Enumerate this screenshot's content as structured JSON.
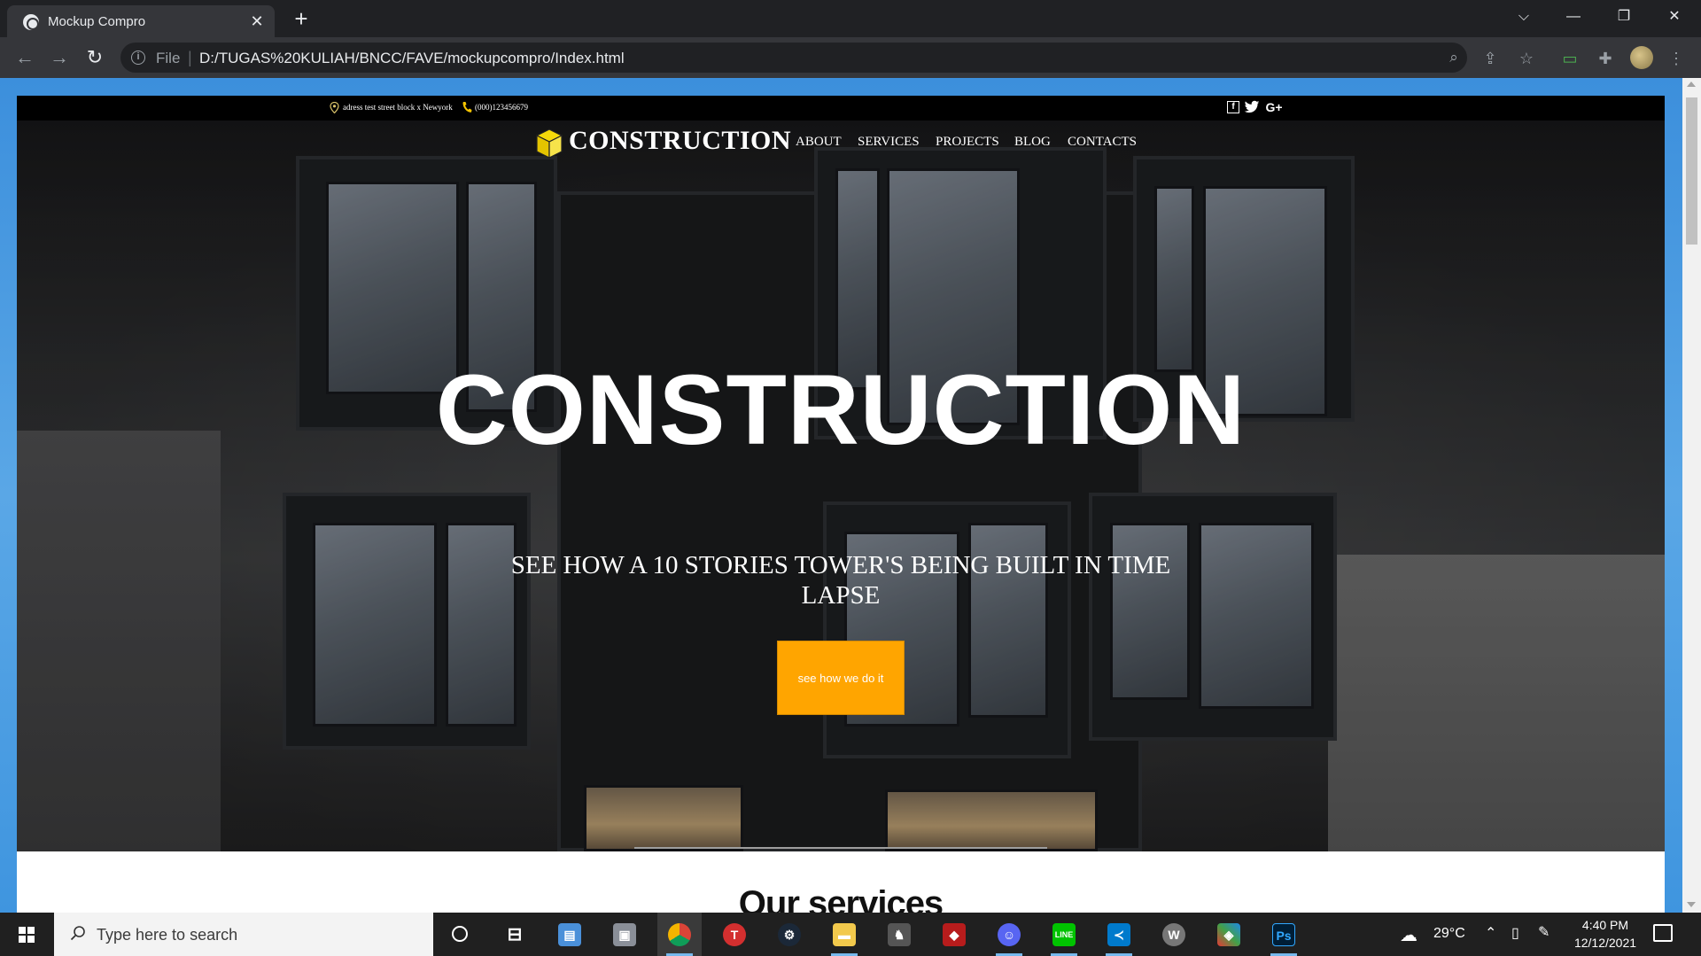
{
  "browser": {
    "tab_title": "Mockup Compro",
    "tab_close": "✕",
    "new_tab": "+",
    "url_scheme": "File",
    "url_separator": "|",
    "url": "D:/TUGAS%20KULIAH/BNCC/FAVE/mockupcompro/Index.html",
    "window_controls": {
      "list": "⌵",
      "minimize": "—",
      "restore": "❐",
      "close": "✕"
    },
    "icons": [
      "back-icon",
      "forward-icon",
      "reload-icon",
      "info-icon",
      "zoom-icon",
      "share-icon",
      "star-icon",
      "cast-icon",
      "extensions-icon",
      "avatar",
      "menu-icon"
    ]
  },
  "site": {
    "topbar": {
      "address": "adress test street block x Newyork",
      "phone": "(000)123456679",
      "social": [
        "f",
        "twitter",
        "G+"
      ]
    },
    "brand": "CONSTRUCTION",
    "nav": [
      "ABOUT",
      "SERVICES",
      "PROJECTS",
      "BLOG",
      "CONTACTS"
    ],
    "hero": {
      "title": "CONSTRUCTION",
      "subtitle": "SEE HOW A 10 STORIES TOWER'S BEING BUILT IN TIME LAPSE",
      "cta": "see how we do it"
    },
    "services_title": "Our services"
  },
  "taskbar": {
    "search_placeholder": "Type here to search",
    "weather": "29°C",
    "time": "4:40 PM",
    "date": "12/12/2021",
    "apps": [
      "cortana",
      "task-view",
      "contacts",
      "network",
      "chrome",
      "t-app",
      "steam",
      "file-explorer",
      "game-app",
      "red-app",
      "discord",
      "line",
      "vscode",
      "w-app",
      "git-app",
      "photoshop"
    ]
  },
  "colors": {
    "cta": "#ffa500",
    "logo_cube": "#f5d90a",
    "page_accent": "#3c8fdc"
  }
}
